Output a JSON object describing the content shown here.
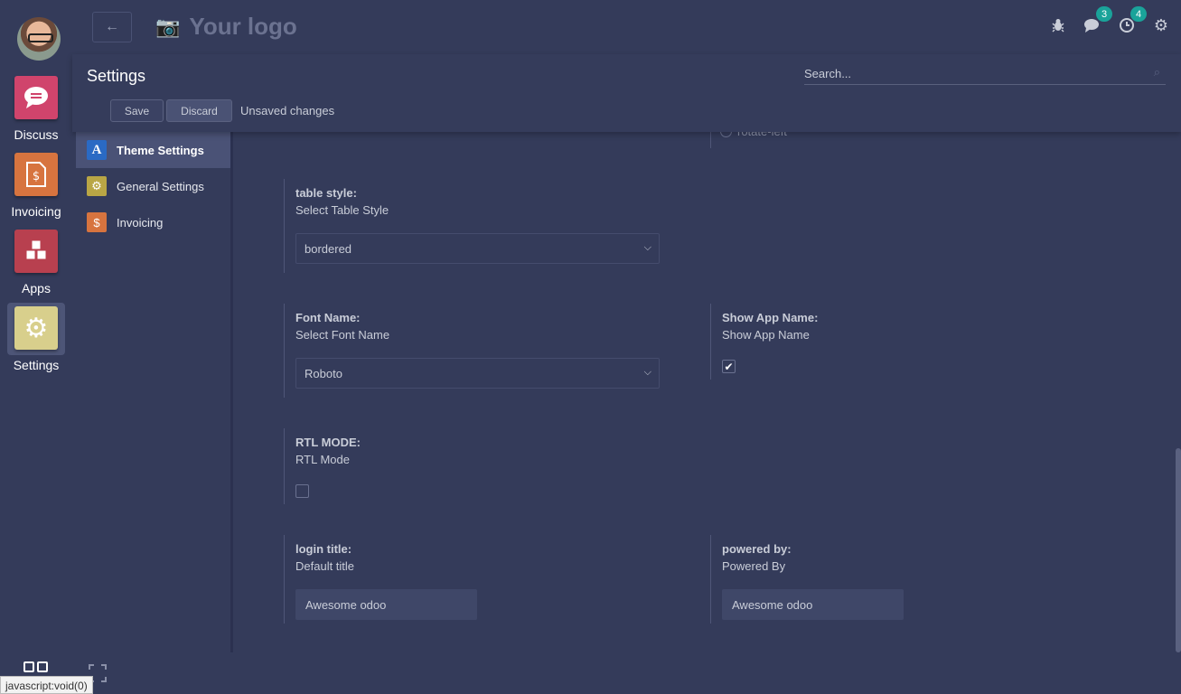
{
  "apps": [
    {
      "label": "Discuss",
      "icon": "chat-bubble-icon",
      "color": "#d0446c"
    },
    {
      "label": "Invoicing",
      "icon": "invoice-icon",
      "color": "#d7743f"
    },
    {
      "label": "Apps",
      "icon": "cubes-icon",
      "color": "#b8404f"
    },
    {
      "label": "Settings",
      "icon": "gear-icon",
      "color": "#d8cf8c"
    }
  ],
  "header": {
    "logo_text": "Your logo",
    "messages_count": "3",
    "activities_count": "4"
  },
  "control": {
    "title": "Settings",
    "search_placeholder": "Search...",
    "save_label": "Save",
    "discard_label": "Discard",
    "unsaved_label": "Unsaved changes"
  },
  "sidebar": {
    "items": [
      {
        "label": "Theme Settings",
        "icon": "A",
        "color": "#2a6ac4"
      },
      {
        "label": "General Settings",
        "icon": "⚙",
        "color": "#b9a645"
      },
      {
        "label": "Invoicing",
        "icon": "$",
        "color": "#d7743f"
      }
    ]
  },
  "form": {
    "rotate_label": "rotate-left",
    "table_style": {
      "title": "table style:",
      "desc": "Select Table Style",
      "value": "bordered"
    },
    "font_name": {
      "title": "Font Name:",
      "desc": "Select Font Name",
      "value": "Roboto"
    },
    "show_app_name": {
      "title": "Show App Name:",
      "desc": "Show App Name",
      "checked": true
    },
    "rtl_mode": {
      "title": "RTL MODE:",
      "desc": "RTL Mode",
      "checked": false
    },
    "login_title": {
      "title": "login title:",
      "desc": "Default title",
      "value": "Awesome odoo"
    },
    "powered_by": {
      "title": "powered by:",
      "desc": "Powered By",
      "value": "Awesome odoo"
    }
  },
  "status_bar_text": "javascript:void(0)"
}
